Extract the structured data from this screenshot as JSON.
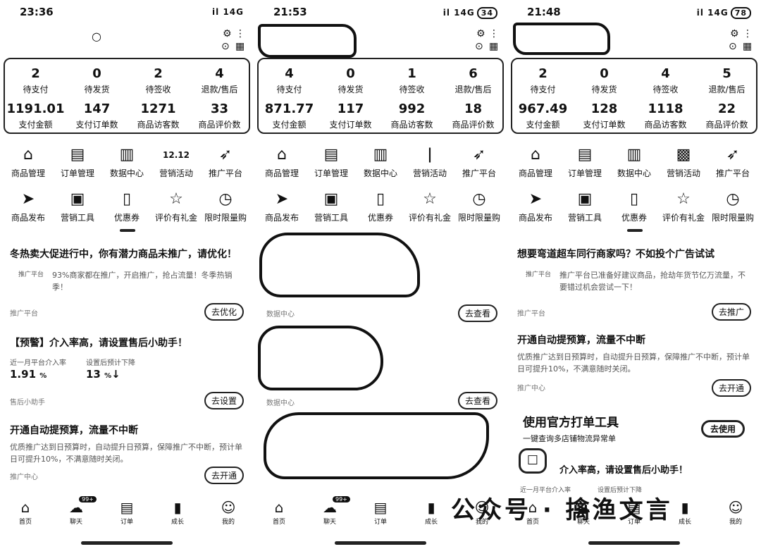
{
  "panels": [
    {
      "time": "23:36",
      "signal": "il 14G",
      "battery": "",
      "shop_name": "",
      "stats": [
        {
          "value": "2",
          "label": "待支付"
        },
        {
          "value": "0",
          "label": "待发货"
        },
        {
          "value": "2",
          "label": "待签收"
        },
        {
          "value": "4",
          "label": "退款/售后"
        },
        {
          "value": "1191.01",
          "label": "支付金额"
        },
        {
          "value": "147",
          "label": "支付订单数"
        },
        {
          "value": "1271",
          "label": "商品访客数"
        },
        {
          "value": "33",
          "label": "商品评价数"
        }
      ],
      "cards": [
        {
          "title": "冬热卖大促进行中，你有潜力商品未推广，请优化！",
          "body": "93%商家都在推广，开启推广，抢占流量！冬季热销季！",
          "foot": "推广平台",
          "button": "去优化"
        },
        {
          "title": "【预警】介入率高，请设置售后小助手！",
          "m1_label": "近一月平台介入率",
          "m1_value": "1.91",
          "m1_unit": "%",
          "m2_label": "设置后预计下降",
          "m2_value": "13",
          "m2_unit": "%",
          "foot": "售后小助手",
          "button": "去设置"
        },
        {
          "title": "开通自动提预算，流量不中断",
          "body": "优质推广达到日预算时，自动提升日预算，保障推广不中断，预计单日可提升10%，不满意随时关闭。",
          "foot": "推广中心",
          "button": "去开通"
        }
      ],
      "chat_badge": "99+"
    },
    {
      "time": "21:53",
      "signal": "il 14G",
      "battery": "34",
      "stats": [
        {
          "value": "4",
          "label": "待支付"
        },
        {
          "value": "0",
          "label": "待发货"
        },
        {
          "value": "1",
          "label": "待签收"
        },
        {
          "value": "6",
          "label": "退款/售后"
        },
        {
          "value": "871.77",
          "label": "支付金额"
        },
        {
          "value": "117",
          "label": "支付订单数"
        },
        {
          "value": "992",
          "label": "商品访客数"
        },
        {
          "value": "18",
          "label": "商品评价数"
        }
      ],
      "cards": [
        {
          "foot": "数据中心",
          "button": "去查看"
        },
        {
          "foot": "数据中心",
          "button": "去查看"
        }
      ],
      "chat_badge": "99+"
    },
    {
      "time": "21:48",
      "signal": "il 14G",
      "battery": "78",
      "stats": [
        {
          "value": "2",
          "label": "待支付"
        },
        {
          "value": "0",
          "label": "待发货"
        },
        {
          "value": "4",
          "label": "待签收"
        },
        {
          "value": "5",
          "label": "退款/售后"
        },
        {
          "value": "967.49",
          "label": "支付金额"
        },
        {
          "value": "128",
          "label": "支付订单数"
        },
        {
          "value": "1118",
          "label": "商品访客数"
        },
        {
          "value": "22",
          "label": "商品评价数"
        }
      ],
      "cards": [
        {
          "title": "想要弯道超车同行商家吗？不如投个广告试试",
          "body": "推广平台已准备好建议商品，抢劫年货节亿万流量，不要错过机会尝试一下！",
          "foot": "推广平台",
          "button": "去推广"
        },
        {
          "title": "开通自动提预算，流量不中断",
          "body": "优质推广达到日预算时，自动提升日预算，保障推广不中断，预计单日可提升10%，不满意随时关闭。",
          "foot": "推广中心",
          "button": "去开通"
        }
      ],
      "promo": {
        "title": "使用官方打单工具",
        "sub": "一键查询多店铺物流异常单",
        "button": "去使用"
      },
      "preview": {
        "title": "介入率高，请设置售后小助手！",
        "m1": "近一月平台介入率",
        "m2": "设置后预计下降"
      }
    }
  ],
  "grid_row1": [
    {
      "label": "商品管理",
      "icon": "bag-icon"
    },
    {
      "label": "订单管理",
      "icon": "list-icon"
    },
    {
      "label": "数据中心",
      "icon": "chart-icon"
    },
    {
      "label": "营销活动",
      "icon": "event-icon"
    },
    {
      "label": "推广平台",
      "icon": "rocket-icon"
    }
  ],
  "grid_row2": [
    {
      "label": "商品发布",
      "icon": "send-icon"
    },
    {
      "label": "营销工具",
      "icon": "toolbox-icon"
    },
    {
      "label": "优惠券",
      "icon": "coupon-icon"
    },
    {
      "label": "评价有礼金",
      "icon": "star-icon"
    },
    {
      "label": "限时限量购",
      "icon": "clock-icon"
    }
  ],
  "event_badge": "12.12",
  "nav": [
    {
      "label": "首页",
      "icon": "home-icon"
    },
    {
      "label": "聊天",
      "icon": "chat-icon"
    },
    {
      "label": "订单",
      "icon": "order-icon"
    },
    {
      "label": "成长",
      "icon": "growth-icon"
    },
    {
      "label": "我的",
      "icon": "profile-icon"
    }
  ],
  "watermark": "公众号 · 擒渔文言"
}
